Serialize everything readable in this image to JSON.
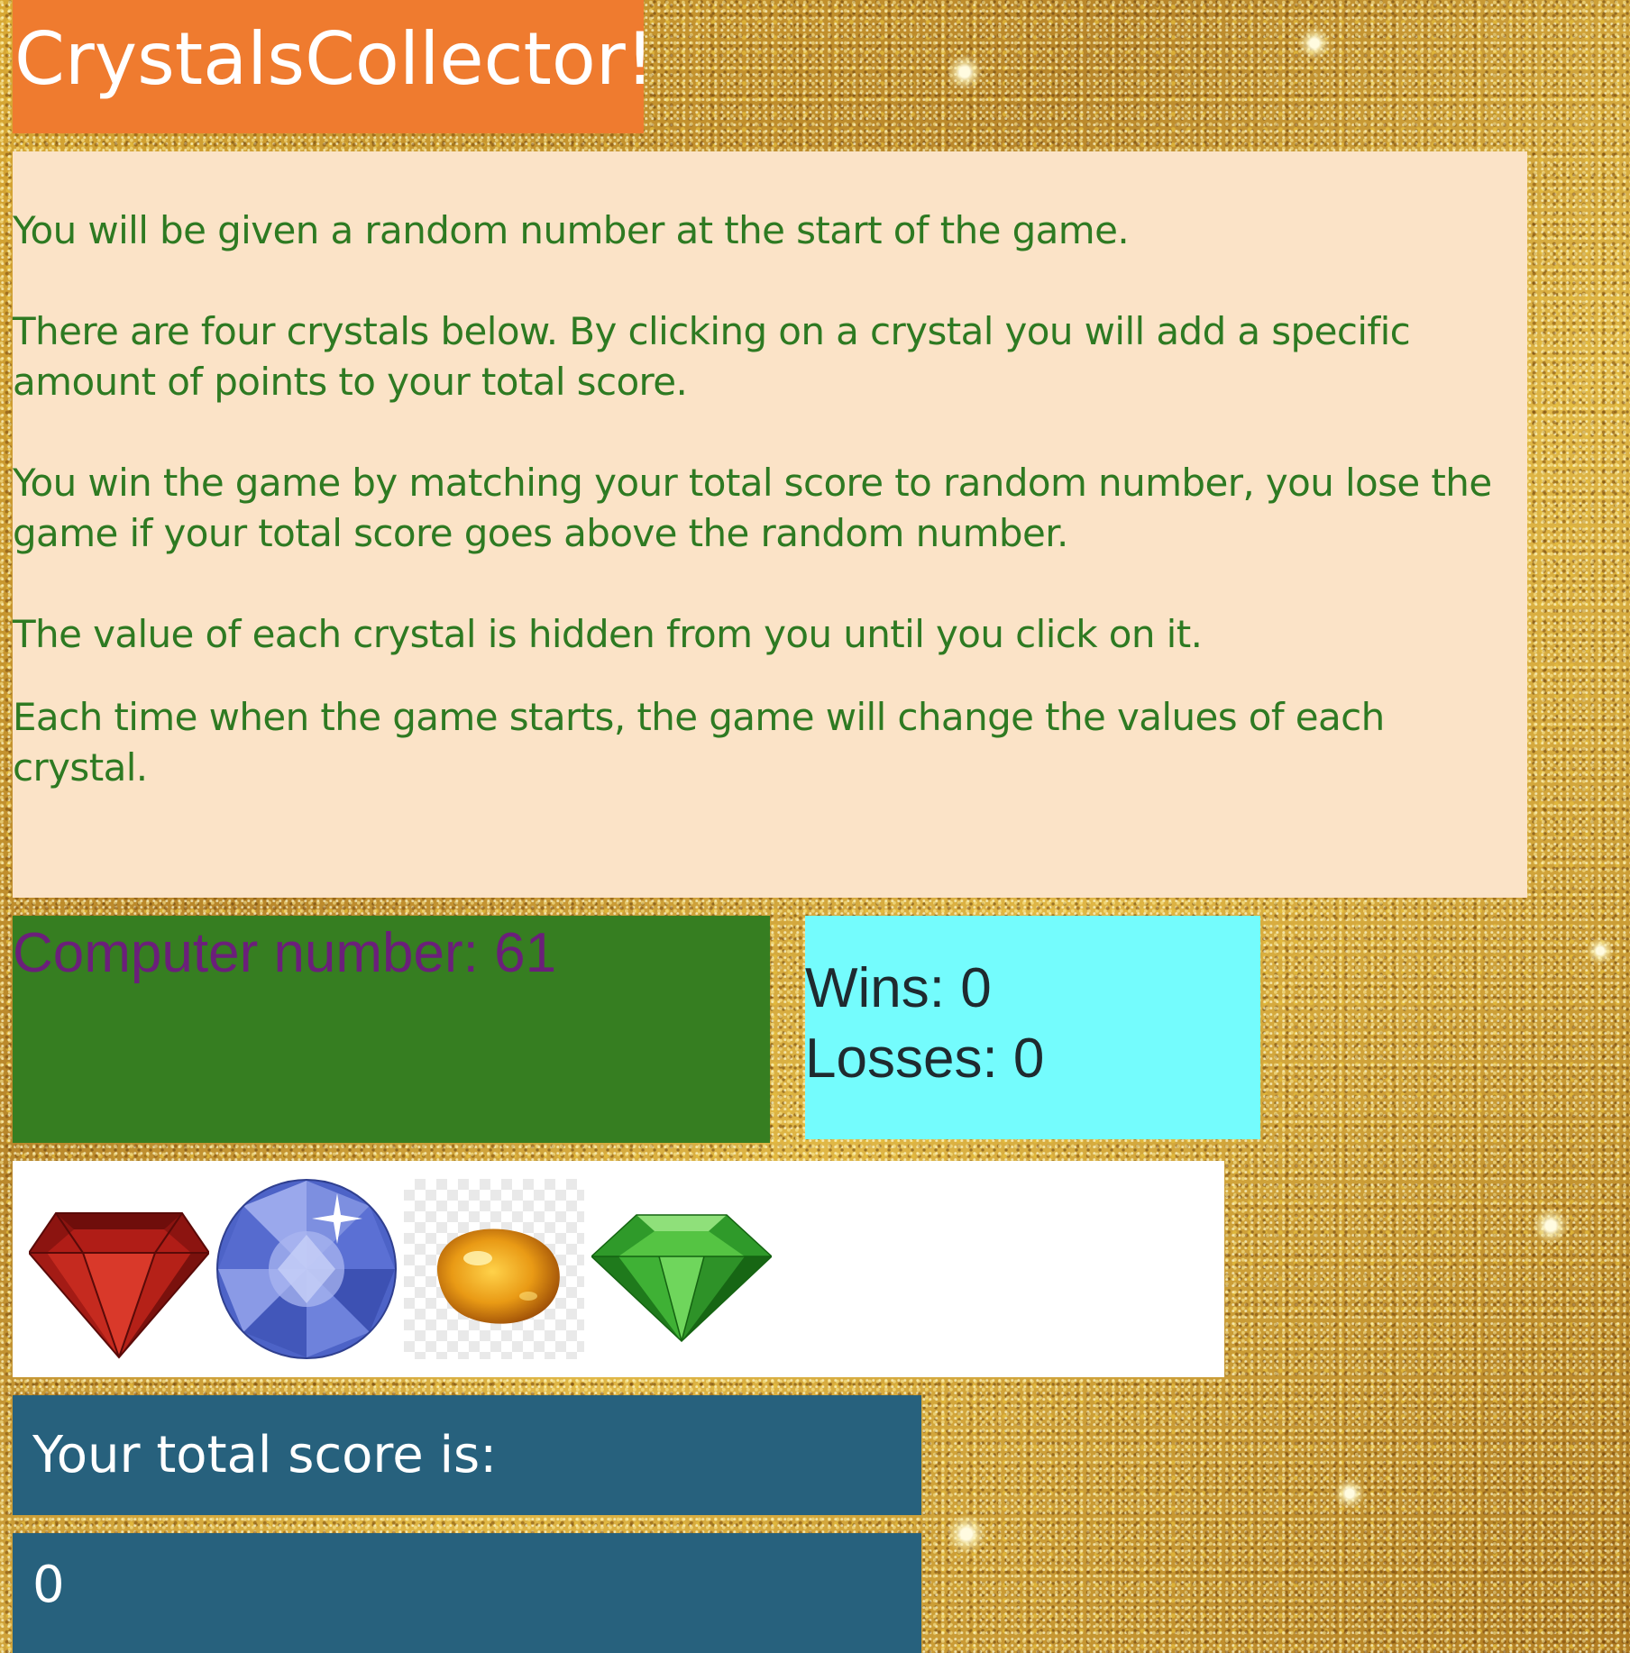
{
  "title": "CrystalsCollector!",
  "instructions": [
    "You will be given a random number at the start of the game.",
    "There are four crystals below. By clicking on a crystal you will add a specific amount of points to your total score.",
    "You win the game by matching your total score to random number, you lose the game if your total score goes above the random number.",
    "The value of each crystal is hidden from you until you click on it.",
    "Each time when the game starts, the game will change the values of each crystal."
  ],
  "computer": {
    "label": "Computer number: 61"
  },
  "record": {
    "wins": "Wins: 0",
    "losses": "Losses: 0"
  },
  "crystals": [
    {
      "icon": "red-ruby-crystal-icon"
    },
    {
      "icon": "blue-sapphire-crystal-icon"
    },
    {
      "icon": "amber-crystal-icon"
    },
    {
      "icon": "green-emerald-crystal-icon"
    }
  ],
  "score": {
    "label": "Your total score is:",
    "value": "0"
  },
  "colors": {
    "title_bg": "#ef7b2f",
    "instructions_bg": "#fbe3c7",
    "instructions_text": "#2e7a22",
    "computer_bg": "#367e21",
    "computer_text": "#6b1f7a",
    "record_bg": "#74fcfd",
    "score_bg": "#27617d"
  }
}
